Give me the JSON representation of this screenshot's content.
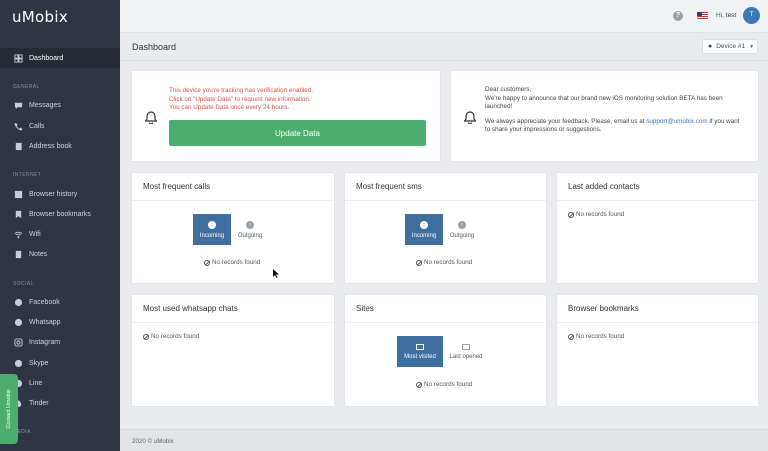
{
  "app": {
    "logo": "uMobix"
  },
  "sidebar": {
    "items": [
      {
        "label": "Dashboard",
        "icon": "dashboard-icon"
      },
      {
        "label": "Messages",
        "icon": "message-icon"
      },
      {
        "label": "Calls",
        "icon": "phone-icon"
      },
      {
        "label": "Address book",
        "icon": "address-book-icon"
      },
      {
        "label": "Browser history",
        "icon": "browser-history-icon"
      },
      {
        "label": "Browser bookmarks",
        "icon": "bookmark-icon"
      },
      {
        "label": "Wifi",
        "icon": "wifi-icon"
      },
      {
        "label": "Notes",
        "icon": "notes-icon"
      },
      {
        "label": "Facebook",
        "icon": "facebook-icon"
      },
      {
        "label": "Whatsapp",
        "icon": "whatsapp-icon"
      },
      {
        "label": "Instagram",
        "icon": "instagram-icon"
      },
      {
        "label": "Skype",
        "icon": "skype-icon"
      },
      {
        "label": "Line",
        "icon": "line-icon"
      },
      {
        "label": "Tinder",
        "icon": "tinder-icon"
      }
    ],
    "sections": {
      "general": "GENERAL",
      "internet": "INTERNET",
      "social": "SOCIAL",
      "media": "MEDIA"
    },
    "contact_tab": "Contact Umobix"
  },
  "topbar": {
    "greeting": "Hi,",
    "username": "test",
    "avatar_letter": "T",
    "help": "?"
  },
  "header": {
    "title": "Dashboard",
    "device": "Device #1"
  },
  "alert": {
    "line1": "This device you're tracking has verification enabled.",
    "line2": "Click on \"Update Data\" to request new information.",
    "line3": "You can Update Data once every 24 hours.",
    "button": "Update Data"
  },
  "notice": {
    "p1": "Dear customers,",
    "p1b": "We're happy to announce that our brand new iOS monitoring solution BETA has been launched!",
    "p2a": "We always appreciate your feedback. Please, email us at",
    "email": "support@umobix.com",
    "p2b": "if you want to share your impressions or suggestions."
  },
  "cards": {
    "calls": {
      "title": "Most frequent calls",
      "on": "Incoming",
      "off": "Outgoing",
      "empty": "No records found"
    },
    "sms": {
      "title": "Most frequent sms",
      "on": "Incoming",
      "off": "Outgoing",
      "empty": "No records found"
    },
    "contacts": {
      "title": "Last added contacts",
      "empty": "No records found"
    },
    "whatsapp": {
      "title": "Most used whatsapp chats",
      "empty": "No records found"
    },
    "sites": {
      "title": "Sites",
      "on": "Most visited",
      "off": "Last opened",
      "empty": "No records found"
    },
    "bookmarks": {
      "title": "Browser bookmarks",
      "empty": "No records found"
    }
  },
  "footer": {
    "text": "2020 © uMobix"
  },
  "colors": {
    "sidebar": "#2f3542",
    "accent_green": "#4bae6f",
    "toggle_blue": "#3f6f9f",
    "alert_red": "#d9534f",
    "link_blue": "#3c77b9"
  }
}
